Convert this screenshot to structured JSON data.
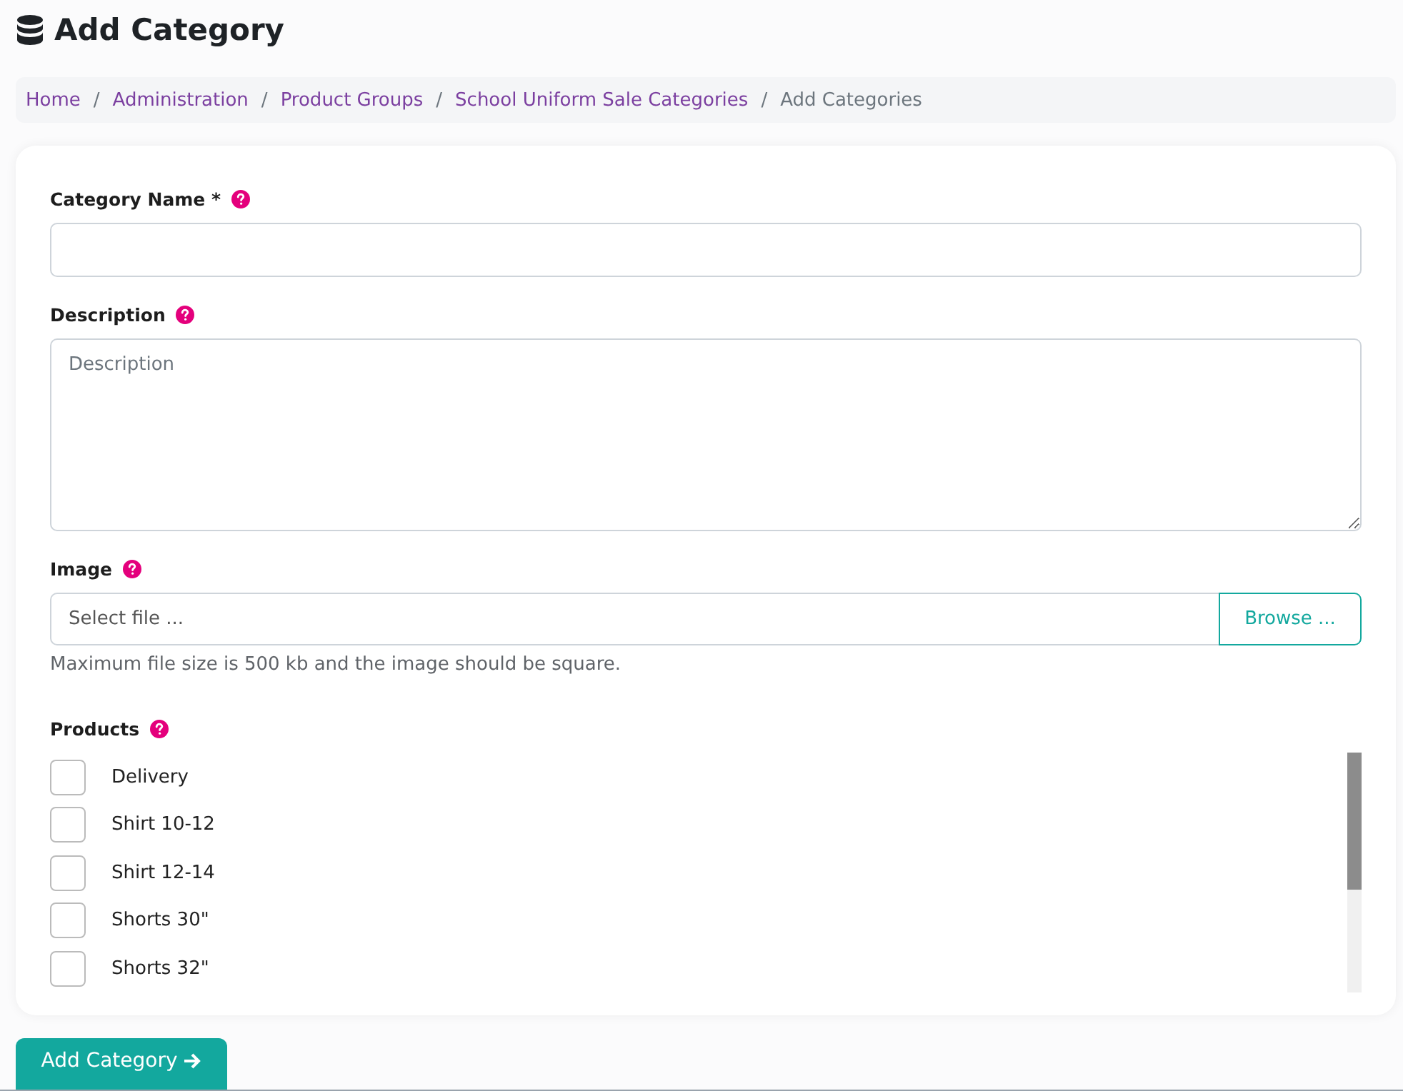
{
  "title": "Add Category",
  "breadcrumb_separator": "/",
  "breadcrumb": [
    {
      "label": "Home",
      "link": true
    },
    {
      "label": "Administration",
      "link": true
    },
    {
      "label": "Product Groups",
      "link": true
    },
    {
      "label": "School Uniform Sale Categories",
      "link": true
    },
    {
      "label": "Add Categories",
      "link": false
    }
  ],
  "form": {
    "category_name": {
      "label": "Category Name *"
    },
    "description": {
      "label": "Description",
      "placeholder": "Description"
    },
    "image": {
      "label": "Image",
      "placeholder": "Select file ...",
      "button": "Browse ...",
      "hint": "Maximum file size is 500 kb and the image should be square."
    },
    "products": {
      "label": "Products",
      "items": [
        {
          "label": "Delivery",
          "checked": false
        },
        {
          "label": "Shirt 10-12",
          "checked": false
        },
        {
          "label": "Shirt 12-14",
          "checked": false
        },
        {
          "label": "Shorts 30\"",
          "checked": false
        },
        {
          "label": "Shorts 32\"",
          "checked": false
        }
      ]
    }
  },
  "submit": "Add Category"
}
